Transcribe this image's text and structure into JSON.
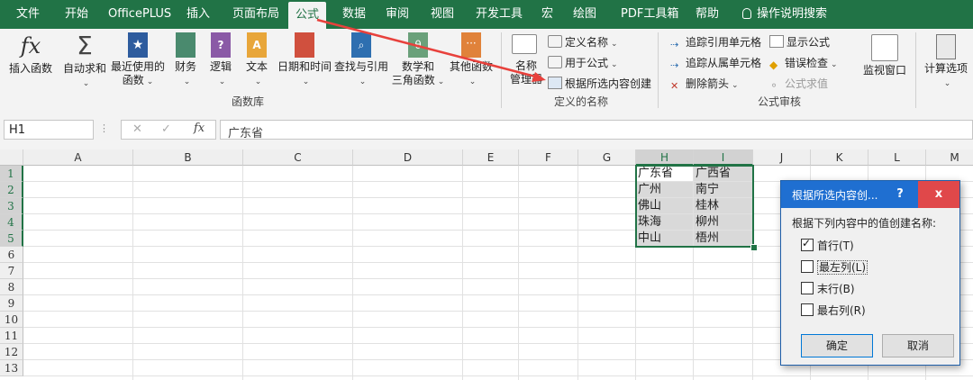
{
  "tabs": [
    "文件",
    "开始",
    "OfficePLUS",
    "插入",
    "页面布局",
    "公式",
    "数据",
    "审阅",
    "视图",
    "开发工具",
    "宏",
    "绘图",
    "PDF工具箱",
    "帮助"
  ],
  "active_tab": "公式",
  "tell_me": "操作说明搜索",
  "ribbon": {
    "insert_function": "插入函数",
    "autosum": "自动求和",
    "recent": "最近使用的",
    "recent2": "函数",
    "financial": "财务",
    "logical": "逻辑",
    "text": "文本",
    "datetime": "日期和时间",
    "lookup": "查找与引用",
    "math": "数学和",
    "math2": "三角函数",
    "more": "其他函数",
    "group_library": "函数库",
    "name_manager": "名称",
    "name_manager2": "管理器",
    "define_name": "定义名称",
    "use_in_formula": "用于公式",
    "create_from_selection": "根据所选内容创建",
    "group_names": "定义的名称",
    "trace_precedents": "追踪引用单元格",
    "trace_dependents": "追踪从属单元格",
    "remove_arrows": "删除箭头",
    "show_formulas": "显示公式",
    "error_checking": "错误检查",
    "evaluate_formula": "公式求值",
    "group_audit": "公式审核",
    "watch_window": "监视窗口",
    "calc_options": "计算选项"
  },
  "formula_bar": {
    "name_box": "H1",
    "fx": "fx",
    "content": "广东省"
  },
  "columns": [
    "A",
    "B",
    "C",
    "D",
    "E",
    "F",
    "G",
    "H",
    "I",
    "J",
    "K",
    "L",
    "M"
  ],
  "rows": [
    "1",
    "2",
    "3",
    "4",
    "5",
    "6",
    "7",
    "8",
    "9",
    "10",
    "11",
    "12",
    "13"
  ],
  "cells": {
    "H": [
      "广东省",
      "广州",
      "佛山",
      "珠海",
      "中山"
    ],
    "I": [
      "广西省",
      "南宁",
      "桂林",
      "柳州",
      "梧州"
    ]
  },
  "dialog": {
    "title": "根据所选内容创...",
    "help": "?",
    "close": "x",
    "prompt": "根据下列内容中的值创建名称:",
    "options": [
      {
        "label": "首行(T)",
        "checked": true
      },
      {
        "label": "最左列(L)",
        "checked": false
      },
      {
        "label": "末行(B)",
        "checked": false
      },
      {
        "label": "最右列(R)",
        "checked": false
      }
    ],
    "ok": "确定",
    "cancel": "取消"
  },
  "colors": {
    "excel_green": "#217346",
    "dialog_title": "#1f6fd1",
    "close_red": "#e0484a",
    "arrow_red": "#e8413c"
  }
}
